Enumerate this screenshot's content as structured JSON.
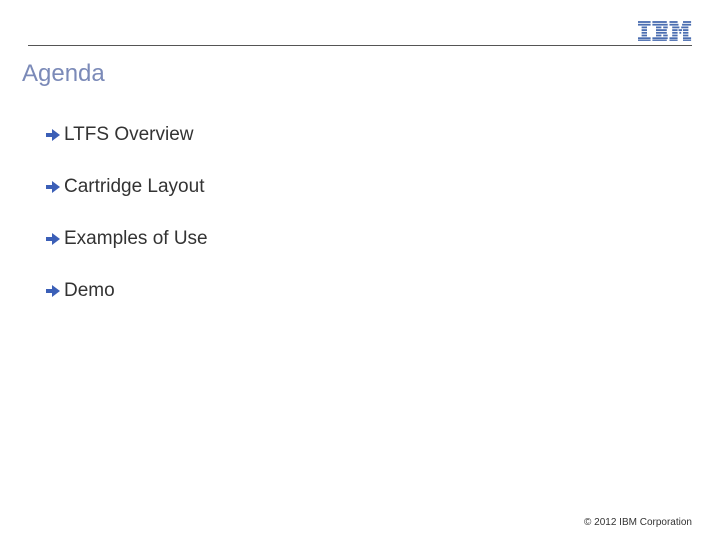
{
  "header": {
    "logo_name": "ibm-logo"
  },
  "title": "Agenda",
  "items": [
    {
      "label": "LTFS Overview"
    },
    {
      "label": "Cartridge Layout"
    },
    {
      "label": "Examples of Use"
    },
    {
      "label": "Demo"
    }
  ],
  "footer": "© 2012 IBM Corporation"
}
